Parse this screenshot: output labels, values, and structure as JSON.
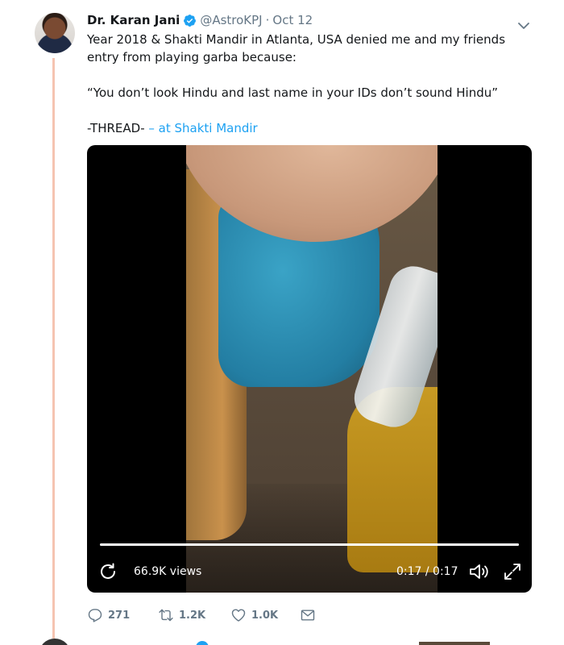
{
  "tweet": {
    "author": {
      "display_name": "Dr. Karan Jani",
      "handle": "@AstroKPJ",
      "verified": true,
      "avatar_icon": "profile-photo"
    },
    "separator": "·",
    "date": "Oct 12",
    "text_lines": [
      "Year 2018 & Shakti Mandir in Atlanta, USA denied me and my friends entry from playing garba because:",
      "“You don’t look Hindu and last name in your IDs don’t sound Hindu”",
      "-THREAD-"
    ],
    "place_text": "– at Shakti Mandir",
    "video": {
      "views": "66.9K views",
      "time": "0:17 / 0:17",
      "progress": 1.0,
      "icons": [
        "replay-icon",
        "volume-icon",
        "fullscreen-icon"
      ]
    },
    "actions": {
      "replies": "271",
      "retweets": "1.2K",
      "likes": "1.0K",
      "icons": [
        "reply-icon",
        "retweet-icon",
        "like-icon",
        "direct-message-icon"
      ]
    }
  },
  "colors": {
    "thread_line": "#f5c4b1",
    "link": "#1da1f2",
    "muted": "#657786",
    "verified": "#1da1f2"
  }
}
